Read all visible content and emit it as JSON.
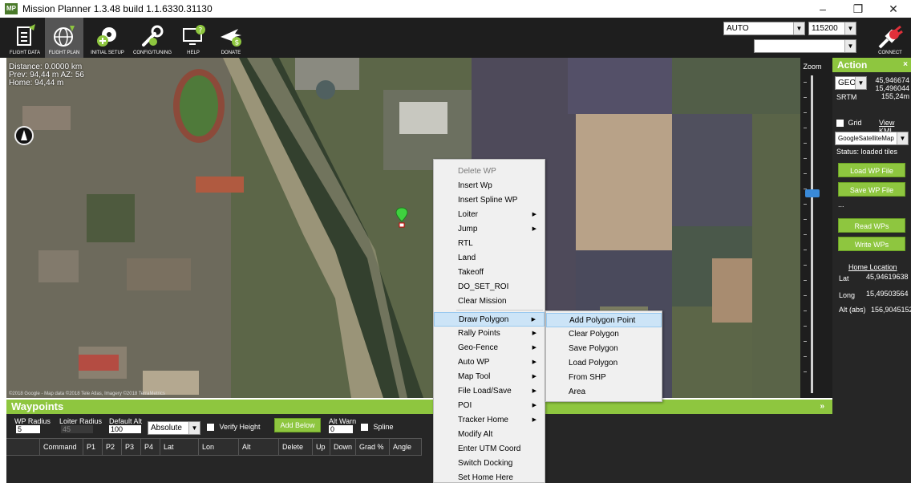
{
  "window": {
    "title": "Mission Planner 1.3.48 build 1.1.6330.31130",
    "icon_text": "MP",
    "minimize": "–",
    "maximize": "❐",
    "close": "✕"
  },
  "toolbar": {
    "buttons": [
      {
        "label": "FLIGHT DATA",
        "icon": "flight-data-icon"
      },
      {
        "label": "FLIGHT PLAN",
        "icon": "globe-icon"
      },
      {
        "label": "INITIAL SETUP",
        "icon": "setup-icon"
      },
      {
        "label": "CONFIG/TUNING",
        "icon": "wrench-icon"
      },
      {
        "label": "HELP",
        "icon": "help-icon"
      },
      {
        "label": "DONATE",
        "icon": "donate-icon"
      }
    ],
    "mode_select": "AUTO",
    "baud_select": "115200",
    "port_select": "",
    "connect_label": "CONNECT"
  },
  "map": {
    "info_lines": [
      "Distance: 0.0000 km",
      "Prev: 94,44 m AZ: 56",
      "Home: 94,44 m"
    ],
    "copyright": "©2018 Google - Map data ©2018 Tele Atlas, Imagery ©2018 TerraMetrics"
  },
  "zoom": {
    "label": "Zoom",
    "level_fraction": 0.37
  },
  "action": {
    "title": "Action",
    "close": "×",
    "coord_system": "GEO",
    "coord_values": [
      "45,946674",
      "15,496044",
      "155,24m"
    ],
    "srtm_label": "SRTM",
    "grid_label": "Grid",
    "view_kml": "View KML",
    "map_type": "GoogleSatelliteMap",
    "status": "Status: loaded tiles",
    "load_wp": "Load WP File",
    "save_wp": "Save WP File",
    "ellipsis": "...",
    "read_wps": "Read WPs",
    "write_wps": "Write WPs",
    "home_location": "Home Location",
    "lat_label": "Lat",
    "lat_value": "45,94619638",
    "long_label": "Long",
    "long_value": "15,49503564",
    "alt_label": "Alt (abs)",
    "alt_value": "156,9045152"
  },
  "waypoints": {
    "title": "Waypoints",
    "chevron": "»",
    "wp_radius_label": "WP Radius",
    "wp_radius_value": "5",
    "loiter_radius_label": "Loiter Radius",
    "loiter_radius_value": "45",
    "default_alt_label": "Default Alt",
    "default_alt_value": "100",
    "alt_mode": "Absolute",
    "verify_height": "Verify Height",
    "add_below": "Add Below",
    "alt_warn_label": "Alt Warn",
    "alt_warn_value": "0",
    "spline": "Spline",
    "columns": [
      "",
      "Command",
      "P1",
      "P2",
      "P3",
      "P4",
      "Lat",
      "Lon",
      "Alt",
      "Delete",
      "Up",
      "Down",
      "Grad %",
      "Angle"
    ]
  },
  "context_menu": {
    "items": [
      {
        "label": "Delete WP",
        "disabled": true,
        "sub": false
      },
      {
        "label": "Insert Wp",
        "disabled": false,
        "sub": false
      },
      {
        "label": "Insert Spline WP",
        "disabled": false,
        "sub": false
      },
      {
        "label": "Loiter",
        "disabled": false,
        "sub": true
      },
      {
        "label": "Jump",
        "disabled": false,
        "sub": true
      },
      {
        "label": "RTL",
        "disabled": false,
        "sub": false
      },
      {
        "label": "Land",
        "disabled": false,
        "sub": false
      },
      {
        "label": "Takeoff",
        "disabled": false,
        "sub": false
      },
      {
        "label": "DO_SET_ROI",
        "disabled": false,
        "sub": false
      },
      {
        "label": "Clear Mission",
        "disabled": false,
        "sub": false
      },
      {
        "label": "Draw Polygon",
        "disabled": false,
        "sub": true,
        "highlight": true
      },
      {
        "label": "Rally Points",
        "disabled": false,
        "sub": true
      },
      {
        "label": "Geo-Fence",
        "disabled": false,
        "sub": true
      },
      {
        "label": "Auto WP",
        "disabled": false,
        "sub": true
      },
      {
        "label": "Map Tool",
        "disabled": false,
        "sub": true
      },
      {
        "label": "File Load/Save",
        "disabled": false,
        "sub": true
      },
      {
        "label": "POI",
        "disabled": false,
        "sub": true
      },
      {
        "label": "Tracker Home",
        "disabled": false,
        "sub": true
      },
      {
        "label": "Modify Alt",
        "disabled": false,
        "sub": false
      },
      {
        "label": "Enter UTM Coord",
        "disabled": false,
        "sub": false
      },
      {
        "label": "Switch Docking",
        "disabled": false,
        "sub": false
      },
      {
        "label": "Set Home Here",
        "disabled": false,
        "sub": false
      }
    ],
    "submenu": [
      "Add Polygon Point",
      "Clear Polygon",
      "Save Polygon",
      "Load Polygon",
      "From SHP",
      "Area"
    ]
  },
  "colors": {
    "accent_green": "#8ec63f",
    "dark_bg": "#262626",
    "toolbar_bg": "#1e1e1e",
    "menu_highlight": "#cce4f7"
  }
}
